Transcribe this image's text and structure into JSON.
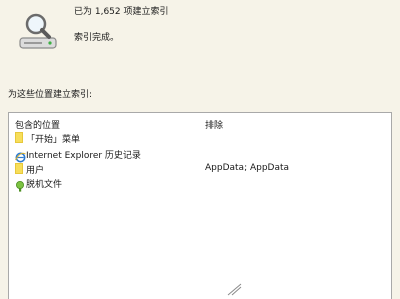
{
  "status": {
    "indexed_count_text": "已为 1,652 项建立索引",
    "message": "索引完成。",
    "icon": "magnifier-over-drive-icon"
  },
  "locations": {
    "section_label": "为这些位置建立索引:",
    "columns": {
      "included": "包含的位置",
      "excluded": "排除"
    },
    "rows": [
      {
        "name": "「开始」菜单",
        "exclude": "",
        "icon": "folder-icon"
      },
      {
        "name": "Internet Explorer 历史记录",
        "exclude": "",
        "icon": "internet-explorer-icon"
      },
      {
        "name": "用户",
        "exclude": "AppData; AppData",
        "icon": "folder-icon"
      },
      {
        "name": "脱机文件",
        "exclude": "",
        "icon": "offline-files-icon"
      }
    ]
  },
  "colors": {
    "window_bg": "#f6f3e8",
    "panel_bg": "#ffffff",
    "folder_yellow": "#f7de5a"
  }
}
